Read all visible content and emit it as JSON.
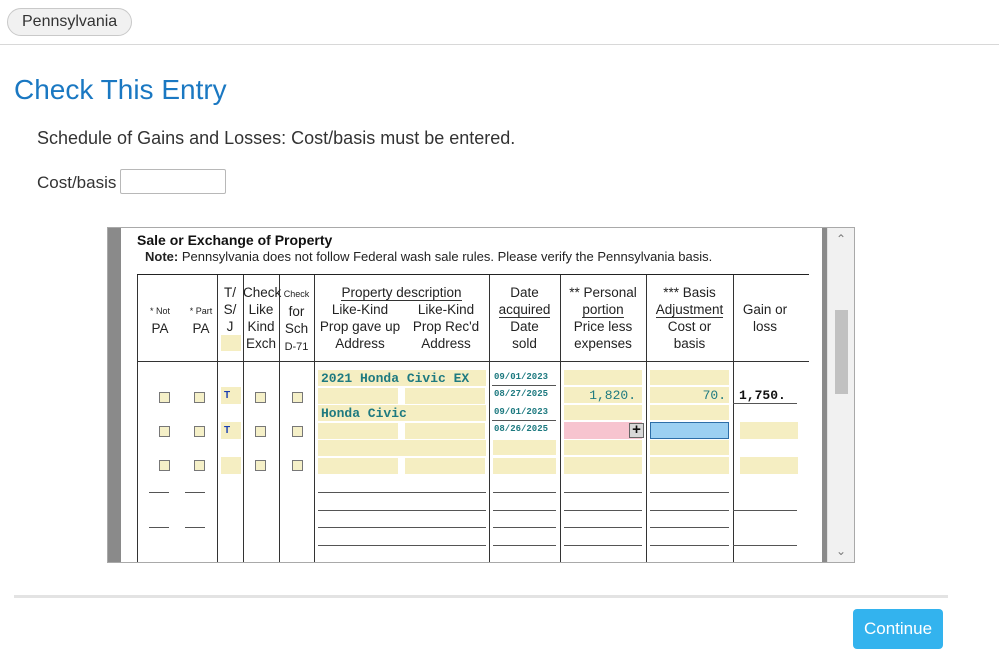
{
  "state_tab": {
    "label": "Pennsylvania"
  },
  "page": {
    "title": "Check This Entry",
    "message": "Schedule of Gains and Losses: Cost/basis must be entered.",
    "cost_basis_label": "Cost/basis",
    "cost_basis_value": ""
  },
  "form": {
    "title": "Sale or Exchange of Property",
    "note_label": "Note:",
    "note_text": " Pennsylvania does not follow Federal wash sale rules. Please verify the Pennsylvania basis.",
    "headers": {
      "not_pa": [
        "* Not",
        "PA"
      ],
      "part_pa": [
        "* Part",
        "PA"
      ],
      "tsj": [
        "T/",
        "S/",
        "J"
      ],
      "check_like": [
        "Check",
        "Like",
        "Kind",
        "Exch"
      ],
      "check_sch": [
        "Check",
        "for",
        "Sch",
        "D-71"
      ],
      "property_description": "Property description",
      "like_kind_gave": [
        "Like-Kind",
        "Prop gave up",
        "Address"
      ],
      "like_kind_recd": [
        "Like-Kind",
        "Prop Rec'd",
        "Address"
      ],
      "date_acquired": [
        "Date",
        "acquired"
      ],
      "date_sold": [
        "Date",
        "sold"
      ],
      "personal_portion": [
        "** Personal",
        "portion"
      ],
      "price_less": [
        "Price less",
        "expenses"
      ],
      "basis_adjustment": [
        "*** Basis",
        "Adjustment"
      ],
      "cost_or_basis": [
        "Cost or",
        "basis"
      ],
      "gain_or_loss": [
        "Gain or",
        "loss"
      ]
    },
    "rows": [
      {
        "tsj": "T",
        "description": "2021 Honda Civic EX",
        "date_acquired": "09/01/2023",
        "date_sold": "08/27/2025",
        "price_less_expenses": "1,820.",
        "cost_or_basis": "70.",
        "gain_or_loss": "1,750."
      },
      {
        "tsj": "T",
        "description": "Honda Civic",
        "date_acquired": "09/01/2023",
        "date_sold": "08/26/2025",
        "price_less_expenses": "",
        "cost_or_basis": "",
        "gain_or_loss": ""
      }
    ]
  },
  "scrollbar": {
    "up_icon": "chevron-up-icon",
    "down_icon": "chevron-down-icon"
  },
  "actions": {
    "continue_label": "Continue"
  },
  "colors": {
    "title": "#1a78c2",
    "button": "#33b3ee",
    "field_yellow": "#f5eec2",
    "error_pink": "#f7c4cf",
    "active_blue": "#9cd0f2"
  }
}
